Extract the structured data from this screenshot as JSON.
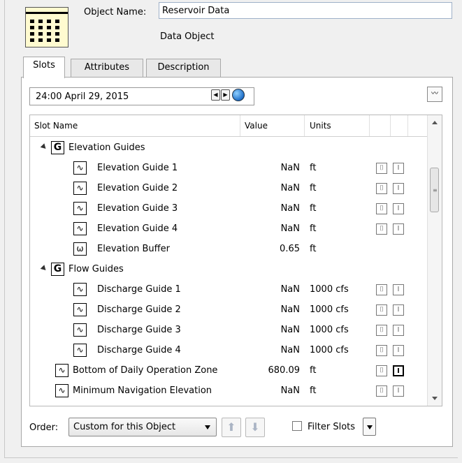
{
  "header": {
    "object_name_label": "Object Name:",
    "object_name_value": "Reservoir Data",
    "object_type": "Data Object",
    "icon": "data-table-icon"
  },
  "tabs": [
    {
      "label": "Slots",
      "active": true
    },
    {
      "label": "Attributes",
      "active": false
    },
    {
      "label": "Description",
      "active": false
    }
  ],
  "toolbar": {
    "date": "24:00 April 29, 2015"
  },
  "table": {
    "columns": [
      "Slot Name",
      "Value",
      "Units"
    ],
    "rows": [
      {
        "type": "group",
        "name": "Elevation Guides"
      },
      {
        "type": "slot",
        "name": "Elevation Guide 1",
        "value": "NaN",
        "units": "ft",
        "flags": true
      },
      {
        "type": "slot",
        "name": "Elevation Guide 2",
        "value": "NaN",
        "units": "ft",
        "flags": true
      },
      {
        "type": "slot",
        "name": "Elevation Guide 3",
        "value": "NaN",
        "units": "ft",
        "flags": true
      },
      {
        "type": "slot",
        "name": "Elevation Guide 4",
        "value": "NaN",
        "units": "ft",
        "flags": true
      },
      {
        "type": "scalar",
        "name": "Elevation Buffer",
        "value": "0.65",
        "units": "ft",
        "flags": false
      },
      {
        "type": "group",
        "name": "Flow Guides"
      },
      {
        "type": "slot",
        "name": "Discharge Guide 1",
        "value": "NaN",
        "units": "1000 cfs",
        "flags": true
      },
      {
        "type": "slot",
        "name": "Discharge Guide 2",
        "value": "NaN",
        "units": "1000 cfs",
        "flags": true
      },
      {
        "type": "slot",
        "name": "Discharge Guide 3",
        "value": "NaN",
        "units": "1000 cfs",
        "flags": true
      },
      {
        "type": "slot",
        "name": "Discharge Guide 4",
        "value": "NaN",
        "units": "1000 cfs",
        "flags": true
      },
      {
        "type": "top",
        "name": "Bottom of Daily Operation Zone",
        "value": "680.09",
        "units": "ft",
        "flags": true,
        "strong": true
      },
      {
        "type": "top",
        "name": "Minimum Navigation Elevation",
        "value": "NaN",
        "units": "ft",
        "flags": true
      }
    ]
  },
  "footer": {
    "order_label": "Order:",
    "order_value": "Custom for this Object",
    "filter_label": "Filter Slots",
    "filter_checked": false
  }
}
